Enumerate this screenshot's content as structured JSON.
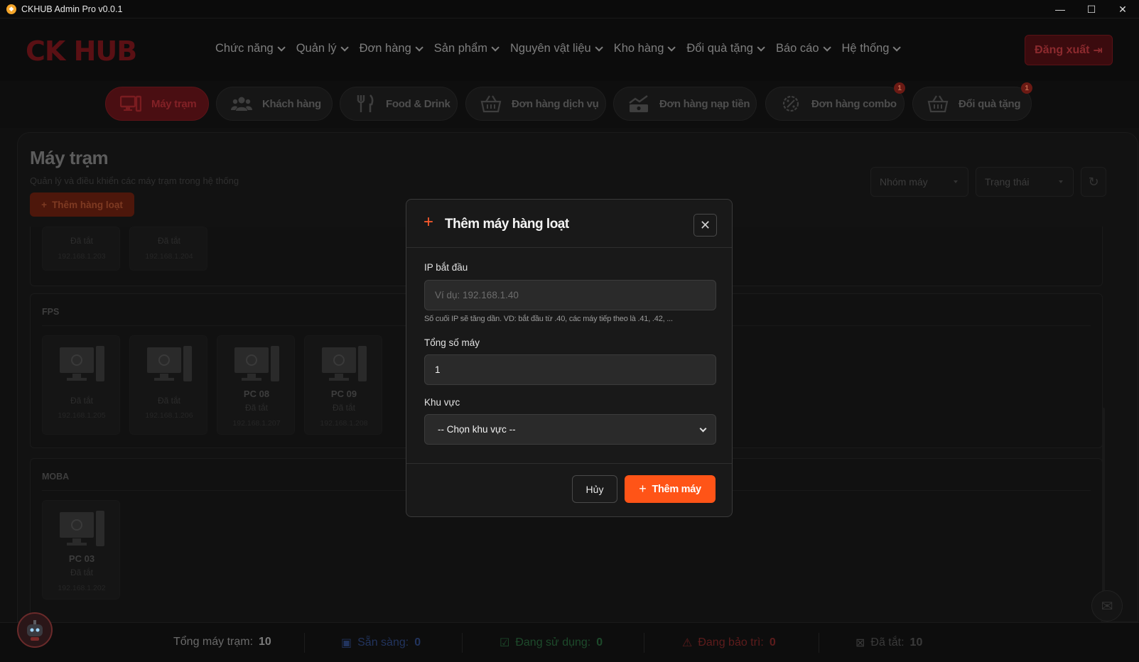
{
  "window": {
    "title": "CKHUB Admin Pro v0.0.1",
    "minimize_glyph": "—",
    "maximize_glyph": "☐",
    "close_glyph": "✕"
  },
  "header": {
    "brand": "CK HUB",
    "nav": [
      "Chức năng",
      "Quản lý",
      "Đơn hàng",
      "Sản phẩm",
      "Nguyên vật liệu",
      "Kho hàng",
      "Đổi quà tặng",
      "Báo cáo",
      "Hệ thống"
    ],
    "logout_label": "Đăng xuất"
  },
  "tabs": [
    {
      "label": "Máy trạm",
      "icon": "workstation-icon",
      "active": true
    },
    {
      "label": "Khách hàng",
      "icon": "users-icon"
    },
    {
      "label": "Food & Drink",
      "icon": "fork-knife-icon"
    },
    {
      "label": "Đơn hàng dịch vụ",
      "icon": "basket-icon"
    },
    {
      "label": "Đơn hàng nạp tiền",
      "icon": "money-chart-icon"
    },
    {
      "label": "Đơn hàng combo",
      "icon": "discount-icon",
      "badge": "1"
    },
    {
      "label": "Đổi quà tặng",
      "icon": "basket-icon",
      "badge": "1"
    }
  ],
  "page": {
    "title": "Máy trạm",
    "subtitle": "Quản lý và điều khiển các máy trạm trong hệ thống",
    "bulk_add_label": "Thêm hàng loạt",
    "filter_group_placeholder": "Nhóm máy",
    "filter_status_placeholder": "Trạng thái"
  },
  "groups": {
    "top_cards": [
      {
        "state": "Đã tắt",
        "ip": "192.168.1.203"
      },
      {
        "state": "Đã tắt",
        "ip": "192.168.1.204"
      }
    ],
    "fps": {
      "title": "FPS",
      "cards": [
        {
          "name": "",
          "state": "Đã tắt",
          "ip": "192.168.1.205"
        },
        {
          "name": "",
          "state": "Đã tắt",
          "ip": "192.168.1.206"
        },
        {
          "name": "PC 08",
          "state": "Đã tắt",
          "ip": "192.168.1.207"
        },
        {
          "name": "PC 09",
          "state": "Đã tắt",
          "ip": "192.168.1.208"
        }
      ]
    },
    "moba": {
      "title": "MOBA",
      "cards": [
        {
          "name": "PC 03",
          "state": "Đã tắt",
          "ip": "192.168.1.202"
        }
      ]
    }
  },
  "footer": {
    "total_label": "Tổng máy trạm:",
    "total_value": "10",
    "ready_label": "Sẵn sàng:",
    "ready_value": "0",
    "in_use_label": "Đang sử dụng:",
    "in_use_value": "0",
    "maintenance_label": "Đang bảo trì:",
    "maintenance_value": "0",
    "off_label": "Đã tắt:",
    "off_value": "10"
  },
  "modal": {
    "title": "Thêm máy hàng loạt",
    "ip_label": "IP bắt đầu",
    "ip_placeholder": "Ví dụ: 192.168.1.40",
    "ip_hint": "Số cuối IP sẽ tăng dần. VD: bắt đầu từ .40, các máy tiếp theo là .41, .42, ...",
    "count_label": "Tổng số máy",
    "count_value": "1",
    "zone_label": "Khu vực",
    "zone_selected": "-- Chọn khu vực --",
    "cancel_label": "Hủy",
    "submit_label": "Thêm máy"
  },
  "colors": {
    "accent": "#ff5417",
    "brand_red": "#c8202a",
    "ready": "#3b6fd8",
    "in_use": "#2ea44f",
    "maintenance": "#d63a3a",
    "off": "#8a8a8a"
  }
}
